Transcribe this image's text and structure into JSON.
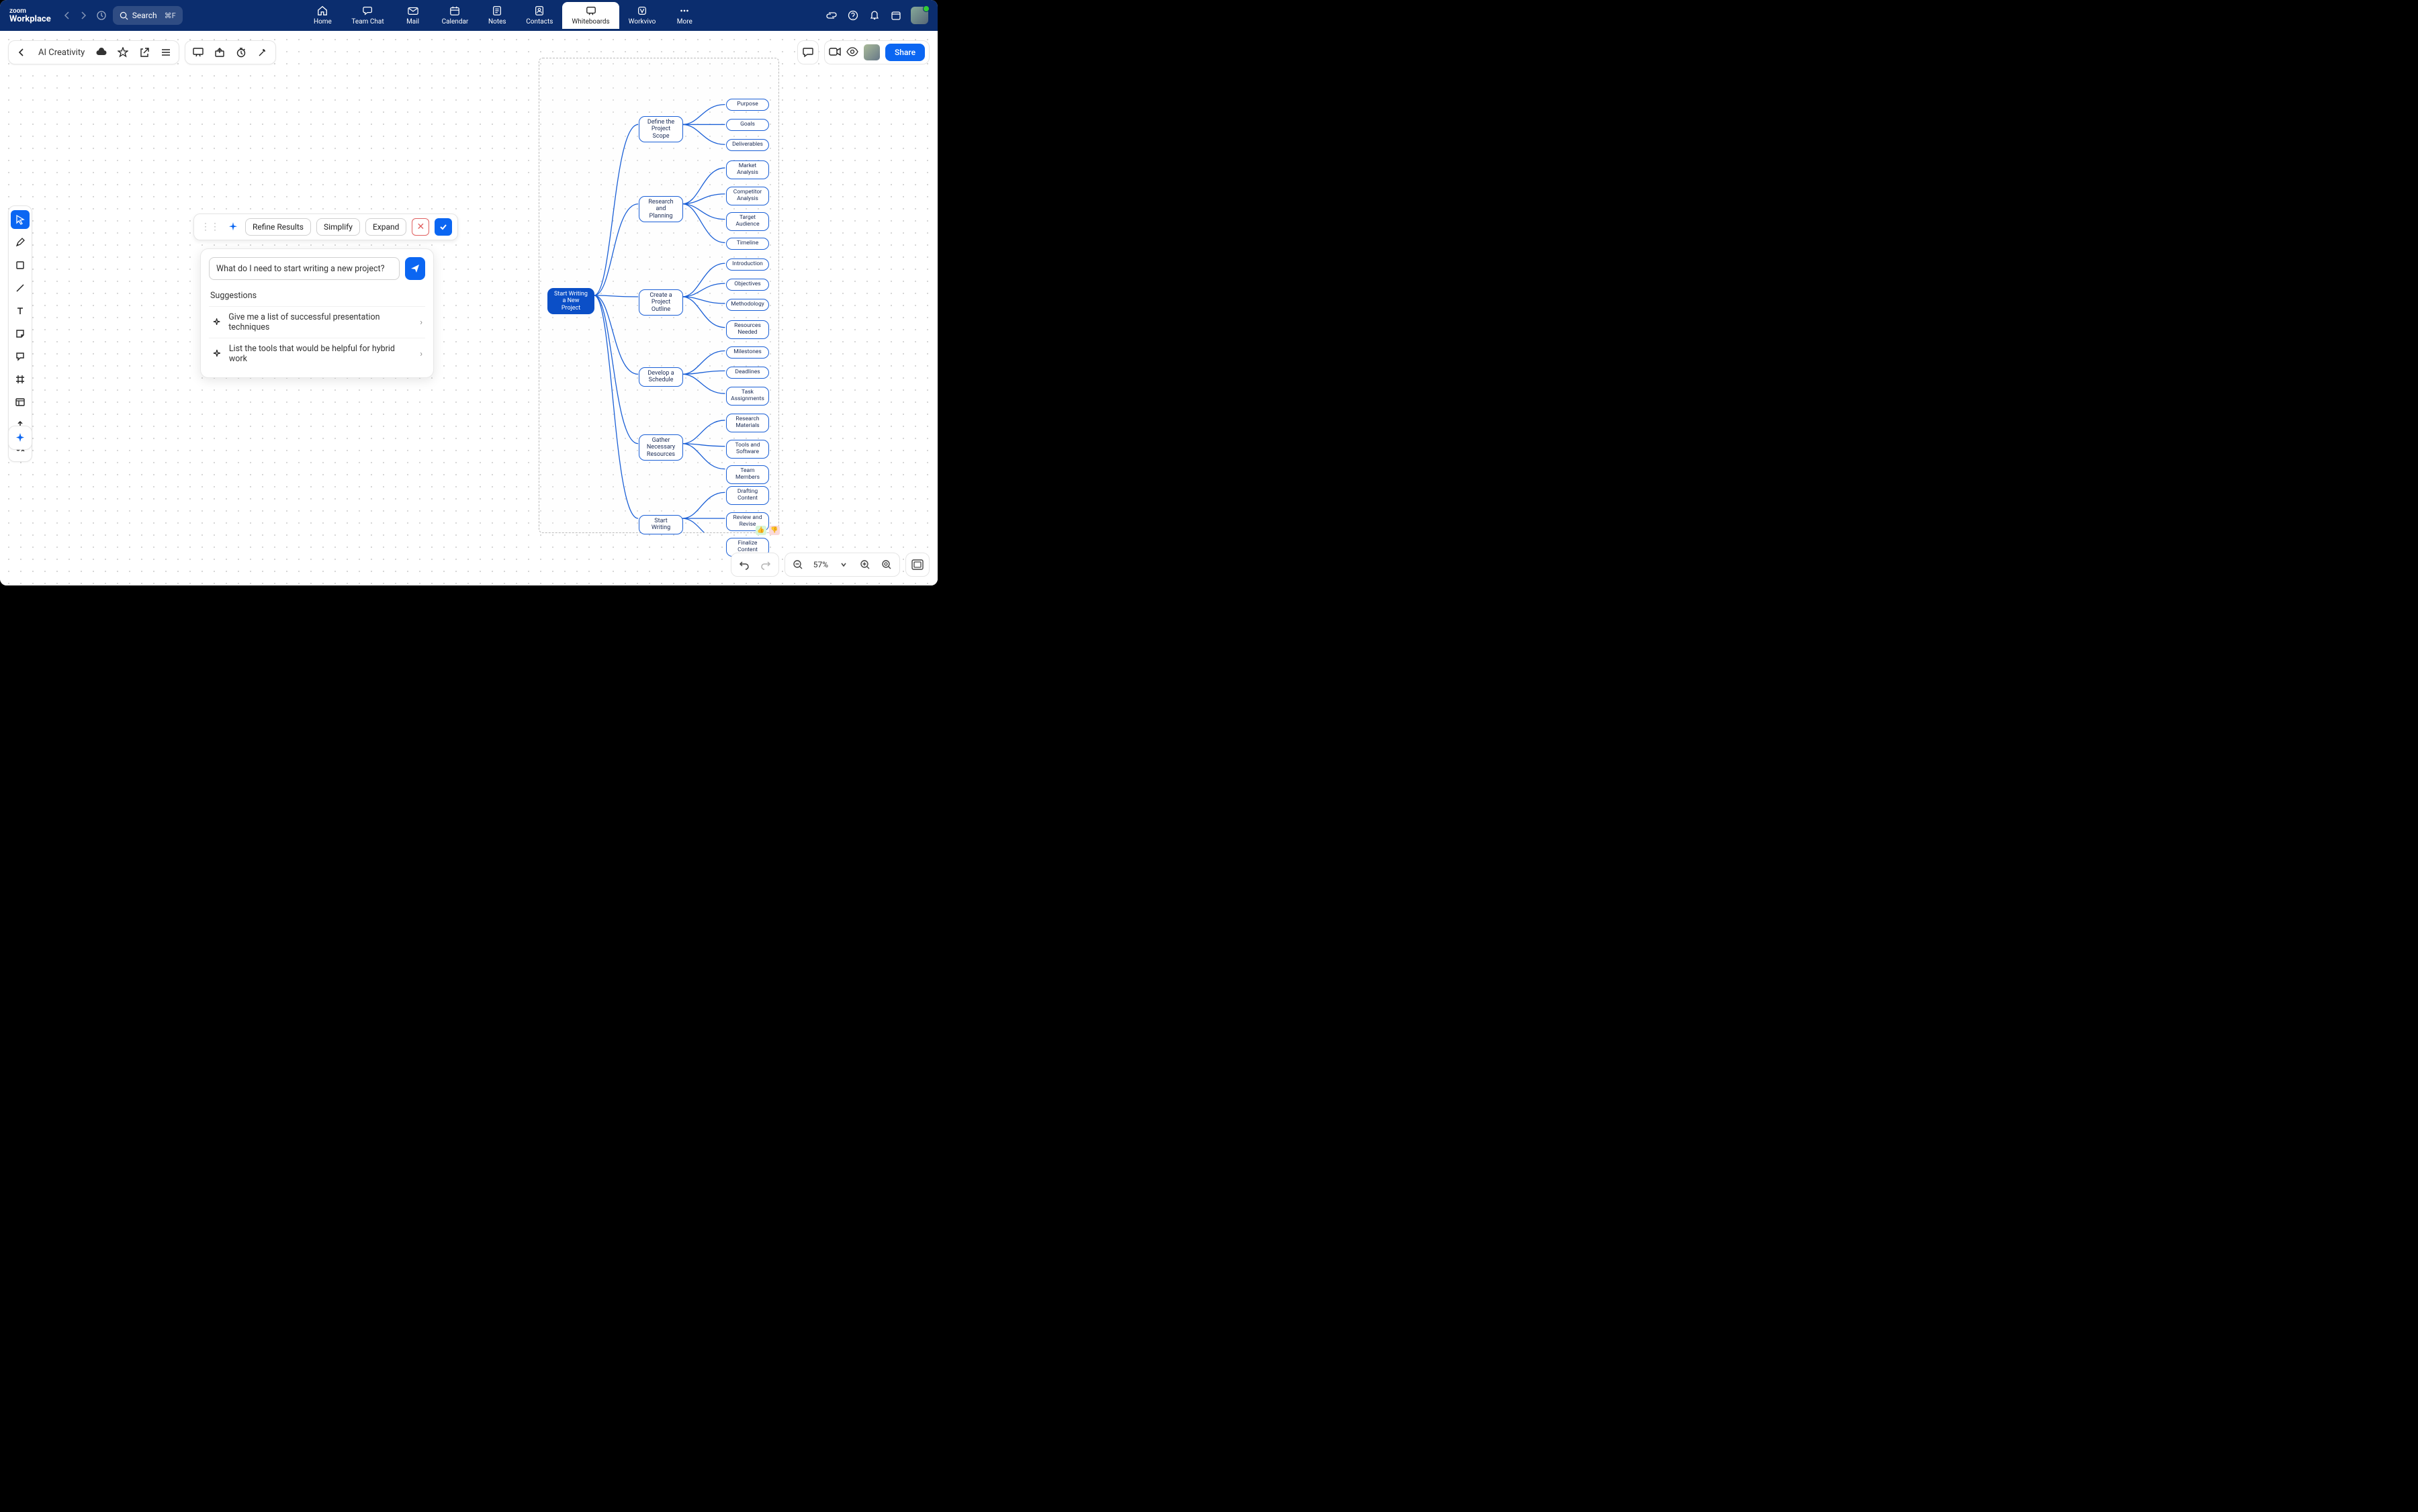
{
  "app": {
    "logo_top": "zoom",
    "logo_bottom": "Workplace"
  },
  "search": {
    "label": "Search",
    "shortcut": "⌘F"
  },
  "topnav": [
    {
      "label": "Home"
    },
    {
      "label": "Team Chat"
    },
    {
      "label": "Mail"
    },
    {
      "label": "Calendar"
    },
    {
      "label": "Notes"
    },
    {
      "label": "Contacts"
    },
    {
      "label": "Whiteboards"
    },
    {
      "label": "Workvivo"
    },
    {
      "label": "More"
    }
  ],
  "board": {
    "title": "AI Creativity"
  },
  "share": {
    "label": "Share"
  },
  "ai_bar": {
    "refine": "Refine Results",
    "simplify": "Simplify",
    "expand": "Expand"
  },
  "ai_panel": {
    "input_value": "What do I need to start writing a new project?",
    "suggestions_title": "Suggestions",
    "suggestions": [
      "Give me a list of successful presentation techniques",
      "List the tools that would be helpful for hybrid work"
    ]
  },
  "mindmap": {
    "root": "Start Writing a New Project",
    "branches": [
      {
        "label": "Define the Project Scope",
        "leaves": [
          "Purpose",
          "Goals",
          "Deliverables"
        ]
      },
      {
        "label": "Research and Planning",
        "leaves": [
          "Market Analysis",
          "Competitor Analysis",
          "Target Audience",
          "Timeline"
        ]
      },
      {
        "label": "Create a Project Outline",
        "leaves": [
          "Introduction",
          "Objectives",
          "Methodology",
          "Resources Needed"
        ]
      },
      {
        "label": "Develop a Schedule",
        "leaves": [
          "Milestones",
          "Deadlines",
          "Task Assignments"
        ]
      },
      {
        "label": "Gather Necessary Resources",
        "leaves": [
          "Research Materials",
          "Tools and Software",
          "Team Members"
        ]
      },
      {
        "label": "Start Writing",
        "leaves": [
          "Drafting Content",
          "Review and Revise",
          "Finalize Content"
        ]
      }
    ]
  },
  "zoom": {
    "level": "57%"
  }
}
